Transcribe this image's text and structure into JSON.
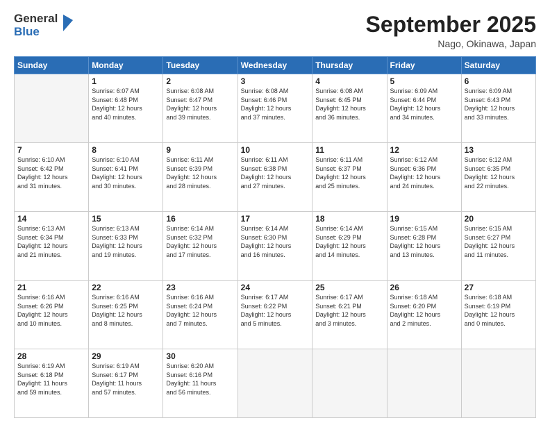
{
  "logo": {
    "general": "General",
    "blue": "Blue"
  },
  "title": "September 2025",
  "location": "Nago, Okinawa, Japan",
  "days_of_week": [
    "Sunday",
    "Monday",
    "Tuesday",
    "Wednesday",
    "Thursday",
    "Friday",
    "Saturday"
  ],
  "weeks": [
    [
      {
        "day": "",
        "info": ""
      },
      {
        "day": "1",
        "info": "Sunrise: 6:07 AM\nSunset: 6:48 PM\nDaylight: 12 hours\nand 40 minutes."
      },
      {
        "day": "2",
        "info": "Sunrise: 6:08 AM\nSunset: 6:47 PM\nDaylight: 12 hours\nand 39 minutes."
      },
      {
        "day": "3",
        "info": "Sunrise: 6:08 AM\nSunset: 6:46 PM\nDaylight: 12 hours\nand 37 minutes."
      },
      {
        "day": "4",
        "info": "Sunrise: 6:08 AM\nSunset: 6:45 PM\nDaylight: 12 hours\nand 36 minutes."
      },
      {
        "day": "5",
        "info": "Sunrise: 6:09 AM\nSunset: 6:44 PM\nDaylight: 12 hours\nand 34 minutes."
      },
      {
        "day": "6",
        "info": "Sunrise: 6:09 AM\nSunset: 6:43 PM\nDaylight: 12 hours\nand 33 minutes."
      }
    ],
    [
      {
        "day": "7",
        "info": "Sunrise: 6:10 AM\nSunset: 6:42 PM\nDaylight: 12 hours\nand 31 minutes."
      },
      {
        "day": "8",
        "info": "Sunrise: 6:10 AM\nSunset: 6:41 PM\nDaylight: 12 hours\nand 30 minutes."
      },
      {
        "day": "9",
        "info": "Sunrise: 6:11 AM\nSunset: 6:39 PM\nDaylight: 12 hours\nand 28 minutes."
      },
      {
        "day": "10",
        "info": "Sunrise: 6:11 AM\nSunset: 6:38 PM\nDaylight: 12 hours\nand 27 minutes."
      },
      {
        "day": "11",
        "info": "Sunrise: 6:11 AM\nSunset: 6:37 PM\nDaylight: 12 hours\nand 25 minutes."
      },
      {
        "day": "12",
        "info": "Sunrise: 6:12 AM\nSunset: 6:36 PM\nDaylight: 12 hours\nand 24 minutes."
      },
      {
        "day": "13",
        "info": "Sunrise: 6:12 AM\nSunset: 6:35 PM\nDaylight: 12 hours\nand 22 minutes."
      }
    ],
    [
      {
        "day": "14",
        "info": "Sunrise: 6:13 AM\nSunset: 6:34 PM\nDaylight: 12 hours\nand 21 minutes."
      },
      {
        "day": "15",
        "info": "Sunrise: 6:13 AM\nSunset: 6:33 PM\nDaylight: 12 hours\nand 19 minutes."
      },
      {
        "day": "16",
        "info": "Sunrise: 6:14 AM\nSunset: 6:32 PM\nDaylight: 12 hours\nand 17 minutes."
      },
      {
        "day": "17",
        "info": "Sunrise: 6:14 AM\nSunset: 6:30 PM\nDaylight: 12 hours\nand 16 minutes."
      },
      {
        "day": "18",
        "info": "Sunrise: 6:14 AM\nSunset: 6:29 PM\nDaylight: 12 hours\nand 14 minutes."
      },
      {
        "day": "19",
        "info": "Sunrise: 6:15 AM\nSunset: 6:28 PM\nDaylight: 12 hours\nand 13 minutes."
      },
      {
        "day": "20",
        "info": "Sunrise: 6:15 AM\nSunset: 6:27 PM\nDaylight: 12 hours\nand 11 minutes."
      }
    ],
    [
      {
        "day": "21",
        "info": "Sunrise: 6:16 AM\nSunset: 6:26 PM\nDaylight: 12 hours\nand 10 minutes."
      },
      {
        "day": "22",
        "info": "Sunrise: 6:16 AM\nSunset: 6:25 PM\nDaylight: 12 hours\nand 8 minutes."
      },
      {
        "day": "23",
        "info": "Sunrise: 6:16 AM\nSunset: 6:24 PM\nDaylight: 12 hours\nand 7 minutes."
      },
      {
        "day": "24",
        "info": "Sunrise: 6:17 AM\nSunset: 6:22 PM\nDaylight: 12 hours\nand 5 minutes."
      },
      {
        "day": "25",
        "info": "Sunrise: 6:17 AM\nSunset: 6:21 PM\nDaylight: 12 hours\nand 3 minutes."
      },
      {
        "day": "26",
        "info": "Sunrise: 6:18 AM\nSunset: 6:20 PM\nDaylight: 12 hours\nand 2 minutes."
      },
      {
        "day": "27",
        "info": "Sunrise: 6:18 AM\nSunset: 6:19 PM\nDaylight: 12 hours\nand 0 minutes."
      }
    ],
    [
      {
        "day": "28",
        "info": "Sunrise: 6:19 AM\nSunset: 6:18 PM\nDaylight: 11 hours\nand 59 minutes."
      },
      {
        "day": "29",
        "info": "Sunrise: 6:19 AM\nSunset: 6:17 PM\nDaylight: 11 hours\nand 57 minutes."
      },
      {
        "day": "30",
        "info": "Sunrise: 6:20 AM\nSunset: 6:16 PM\nDaylight: 11 hours\nand 56 minutes."
      },
      {
        "day": "",
        "info": ""
      },
      {
        "day": "",
        "info": ""
      },
      {
        "day": "",
        "info": ""
      },
      {
        "day": "",
        "info": ""
      }
    ]
  ]
}
